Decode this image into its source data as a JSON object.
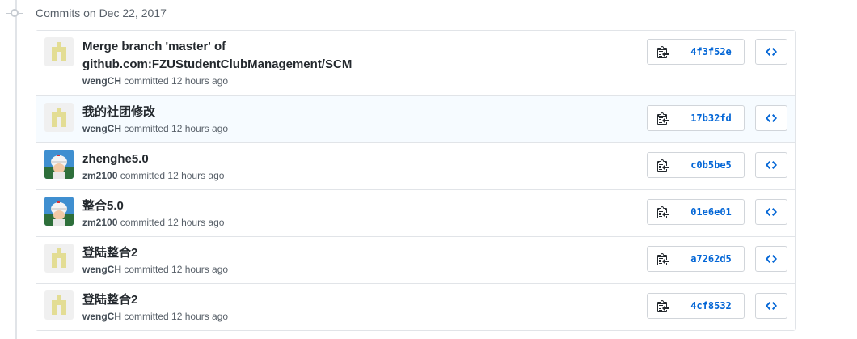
{
  "group_title": "Commits on Dec 22, 2017",
  "commits": [
    {
      "title_lines": [
        "Merge branch 'master' of",
        "github.com:FZUStudentClubManagement/SCM"
      ],
      "author": "wengCH",
      "meta_suffix": "committed 12 hours ago",
      "sha": "4f3f52e",
      "avatar": "identicon"
    },
    {
      "title_lines": [
        "我的社团修改"
      ],
      "author": "wengCH",
      "meta_suffix": "committed 12 hours ago",
      "sha": "17b32fd",
      "avatar": "identicon"
    },
    {
      "title_lines": [
        "zhenghe5.0"
      ],
      "author": "zm2100",
      "meta_suffix": "committed 12 hours ago",
      "sha": "c0b5be5",
      "avatar": "photo"
    },
    {
      "title_lines": [
        "整合5.0"
      ],
      "author": "zm2100",
      "meta_suffix": "committed 12 hours ago",
      "sha": "01e6e01",
      "avatar": "photo"
    },
    {
      "title_lines": [
        "登陆整合2"
      ],
      "author": "wengCH",
      "meta_suffix": "committed 12 hours ago",
      "sha": "a7262d5",
      "avatar": "identicon"
    },
    {
      "title_lines": [
        "登陆整合2"
      ],
      "author": "wengCH",
      "meta_suffix": "committed 12 hours ago",
      "sha": "4cf8532",
      "avatar": "identicon"
    }
  ],
  "icons": {
    "timeline": "git-commit-icon",
    "copy": "clipboard-icon",
    "browse": "code-icon"
  },
  "colors": {
    "sha_link": "#0366d6",
    "identicon": "#e3dd94",
    "highlight_row": "#f6fbff"
  }
}
